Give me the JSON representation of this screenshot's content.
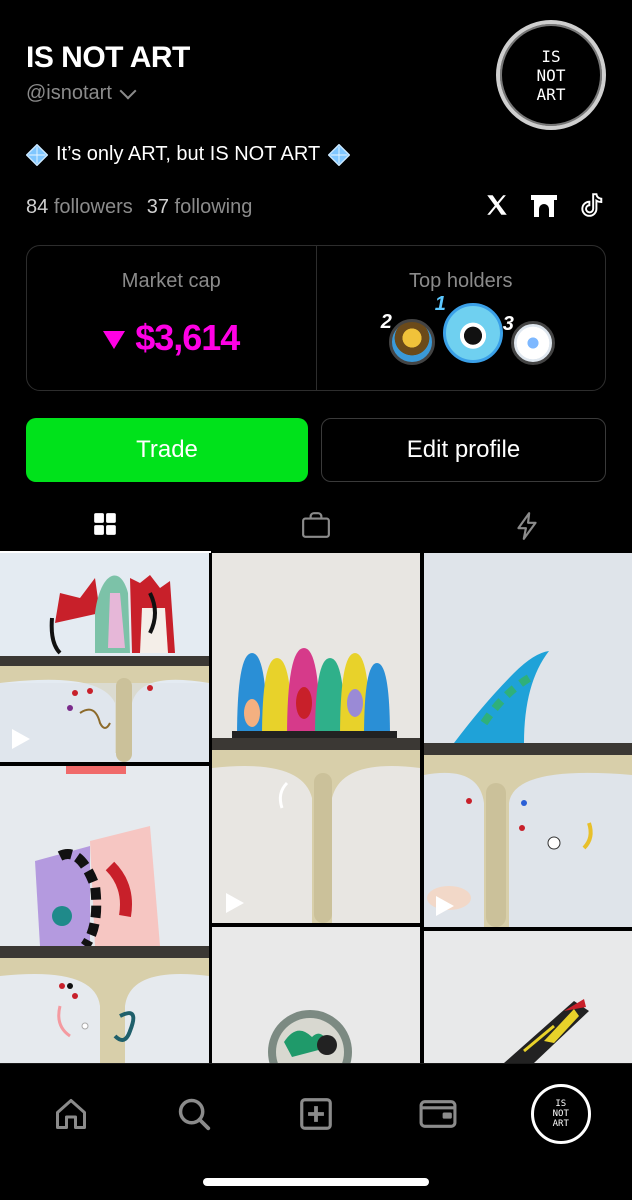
{
  "profile": {
    "name": "IS NOT ART",
    "handle": "@isnotart",
    "avatar_text_lines": [
      "IS",
      "NOT",
      "ART"
    ],
    "bio": "It’s only ART, but IS NOT ART",
    "followers_count": "84",
    "followers_label": "followers",
    "following_count": "37",
    "following_label": "following",
    "socials": [
      "x-icon",
      "bridge-icon",
      "tiktok-icon"
    ]
  },
  "market": {
    "cap_label": "Market cap",
    "cap_value": "$3,614",
    "trend": "down",
    "holders_label": "Top holders",
    "holders": [
      {
        "rank": "2"
      },
      {
        "rank": "1"
      },
      {
        "rank": "3"
      }
    ]
  },
  "actions": {
    "trade_label": "Trade",
    "edit_label": "Edit profile"
  },
  "tabs": [
    {
      "icon": "grid-icon",
      "active": true
    },
    {
      "icon": "shop-bag-icon",
      "active": false
    },
    {
      "icon": "lightning-icon",
      "active": false
    }
  ],
  "nav": [
    "home-icon",
    "search-icon",
    "create-icon",
    "wallet-icon",
    "profile-avatar"
  ],
  "colors": {
    "accent_green": "#00e21b",
    "market_cap_magenta": "#ff00e5",
    "muted_text": "#8b8b8b",
    "background": "#000000"
  }
}
